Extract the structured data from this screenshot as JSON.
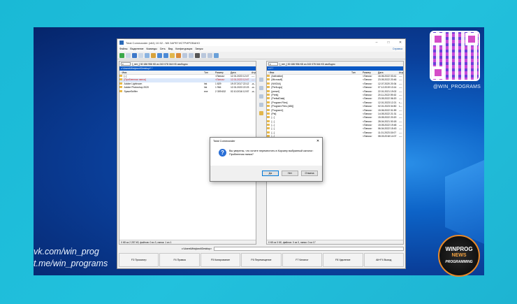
{
  "desktop": {
    "qr_label": "@WIN_PROGRAMS",
    "links": [
      "vk.com/win_prog",
      "t.me/win_programs"
    ],
    "badge": {
      "line1": "WINPROG",
      "line2": "NEWS",
      "line3": "PROGRAMMING"
    },
    "colors": {
      "background": "#1ab9d6",
      "desktop": "#0a3f9a",
      "badge_ring": "#e88a2a"
    }
  },
  "window": {
    "title": "Total Commander (x64) 10.52 - NB ЗАРЕГИСТРИРОВАНО",
    "menu": [
      "Файлы",
      "Выделение",
      "Команды",
      "Сеть",
      "Вид",
      "Конфигурация",
      "Запуск"
    ],
    "menu_right": "Справка",
    "toolbar_icons": [
      "refresh-icon",
      "brief-view-icon",
      "full-view-icon",
      "tree-view-icon",
      "sort-icon",
      "invert-icon",
      "back-icon",
      "forward-icon",
      "pack-icon",
      "unpack-icon",
      "find-icon",
      "ftp-icon",
      "rename-icon",
      "compare-icon",
      "sync-icon",
      "notepad-icon"
    ]
  },
  "left_panel": {
    "drive": "c",
    "drive_info": "[_нет_]  30 186 956 KБ из 243 078 044 KБ свободно",
    "path": "c:\\Users\\Mistyland\\Desktop\\*.*",
    "columns": [
      "↑Имя",
      "Тип",
      "Размер",
      "Дата",
      "Атриб"
    ],
    "rows": [
      {
        "name": "[..]",
        "type": "",
        "size": "<Папка>",
        "date": "12.01.2023 12:47",
        "attr": "----",
        "style": "normal"
      },
      {
        "name": "[Пробленная папка]",
        "type": "",
        "size": "<Папка>",
        "date": "12.01.2023 12:47",
        "attr": "----",
        "style": "red"
      },
      {
        "name": "Adobe Lightroom",
        "type": "lnk",
        "size": "1 829",
        "date": "19.07.2017 22:12",
        "attr": "-a--",
        "style": "normal"
      },
      {
        "name": "Adobe Photoshop 2020",
        "type": "lnk",
        "size": "1 964",
        "date": "12.01.2023 22:23",
        "attr": "-a--",
        "style": "normal"
      },
      {
        "name": "SpaceSniffer",
        "type": "exe",
        "size": "2 309 632",
        "date": "02.10.2016 12:57",
        "attr": "-a--",
        "style": "normal"
      }
    ],
    "status": "0 Кб из 2 257 Кб, файлов: 0 из 3, папок: 1 из 1"
  },
  "right_panel": {
    "drive": "c",
    "drive_info": "[_нет_]  30 186 956 KБ из 243 078 044 KБ свободно",
    "path": "c:\\*.*",
    "columns": [
      "↑Имя",
      "Тип",
      "Размер",
      "Дата",
      "Атриб"
    ],
    "rows": [
      {
        "name": "[Activation]",
        "size": "<Папка>",
        "date": "16.06.2022 03:41",
        "attr": "----"
      },
      {
        "name": "[Microsoft]",
        "size": "<Папка>",
        "date": "23.05.2022 20:46",
        "attr": "----"
      },
      {
        "name": "[NVIDIA]",
        "size": "<Папка>",
        "date": "12.07.2020 20:34",
        "attr": "----"
      },
      {
        "name": "[PerfLogs]",
        "size": "<Папка>",
        "date": "07.12.2019 13:14",
        "attr": "----"
      },
      {
        "name": "[preset]",
        "size": "<Папка>",
        "date": "22.01.2021 19:02",
        "attr": "----"
      },
      {
        "name": "[Prefs]",
        "size": "<Папка>",
        "date": "20.11.2022 09:43",
        "attr": "----"
      },
      {
        "name": "[PrefsdData]",
        "size": "<Папка>",
        "date": "23.05.2022 06:20",
        "attr": "----"
      },
      {
        "name": "[Program Files]",
        "size": "<Папка>",
        "date": "12.01.2023 12:21",
        "attr": "r---"
      },
      {
        "name": "[Program Files (x86)]",
        "size": "<Папка>",
        "date": "02.01.2023 04:50",
        "attr": "r---"
      },
      {
        "name": "[Program1]",
        "size": "<Папка>",
        "date": "15.06.2022 01:59",
        "attr": "----"
      },
      {
        "name": "[Pst]",
        "size": "<Папка>",
        "date": "14.05.2022 21:31",
        "attr": "----"
      },
      {
        "name": "[...]",
        "size": "<Папка>",
        "date": "15.05.2022 20:20",
        "attr": "----"
      },
      {
        "name": "[...]",
        "size": "<Папка>",
        "date": "28.04.2021 00:18",
        "attr": "----"
      },
      {
        "name": "[...]",
        "size": "<Папка>",
        "date": "15.05.2022 19:48",
        "attr": "----"
      },
      {
        "name": "[...]",
        "size": "<Папка>",
        "date": "06.04.2022 15:43",
        "attr": "----"
      },
      {
        "name": "[...]",
        "size": "<Папка>",
        "date": "11.01.2023 15:07",
        "attr": "----"
      },
      {
        "name": "[...]",
        "size": "<Папка>",
        "date": "08.03.2018 14:07",
        "attr": "----"
      }
    ],
    "status": "0 Кб из 0 Кб, файлов: 0 из 0, папок: 0 из 17"
  },
  "cmdline": {
    "path": "c:\\Users\\Mistyland\\Desktop>",
    "value": ""
  },
  "fkeys": [
    "F3 Просмотр",
    "F4 Правка",
    "F5 Копирование",
    "F6 Перемещение",
    "F7 Каталог",
    "F8 Удаление",
    "Alt+F4 Выход"
  ],
  "dialog": {
    "title": "Total Commander",
    "message": "Вы уверены, что хотите переместить в Корзину выбранный каталог: Пробленная папка?",
    "buttons": [
      "Да",
      "Нет",
      "Отмена"
    ]
  }
}
